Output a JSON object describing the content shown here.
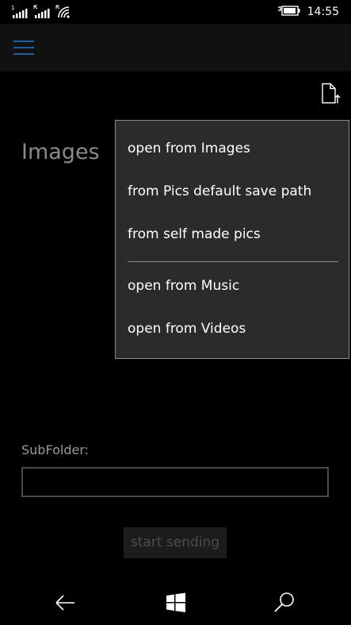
{
  "status_bar": {
    "sim1_label": "1",
    "sim2_label": "2",
    "time": "14:55",
    "icons": [
      "signal-strength-icon",
      "signal-strength-icon",
      "wifi-icon",
      "battery-charging-icon"
    ]
  },
  "app_bar": {
    "menu_icon": "hamburger-menu-icon",
    "accent_color": "#1f5f9e"
  },
  "page": {
    "title": "Images",
    "upload_icon": "document-upload-icon"
  },
  "flyout": {
    "items": [
      {
        "label": "open from Images"
      },
      {
        "label": "from Pics default save path"
      },
      {
        "label": "from self made pics"
      },
      {
        "label": "open from Music"
      },
      {
        "label": "open from Videos"
      }
    ]
  },
  "form": {
    "subfolder_label": "SubFolder:",
    "subfolder_value": "",
    "send_label": "start sending"
  },
  "nav_bar": {
    "icons": [
      "back-arrow-icon",
      "windows-start-icon",
      "search-icon"
    ]
  }
}
